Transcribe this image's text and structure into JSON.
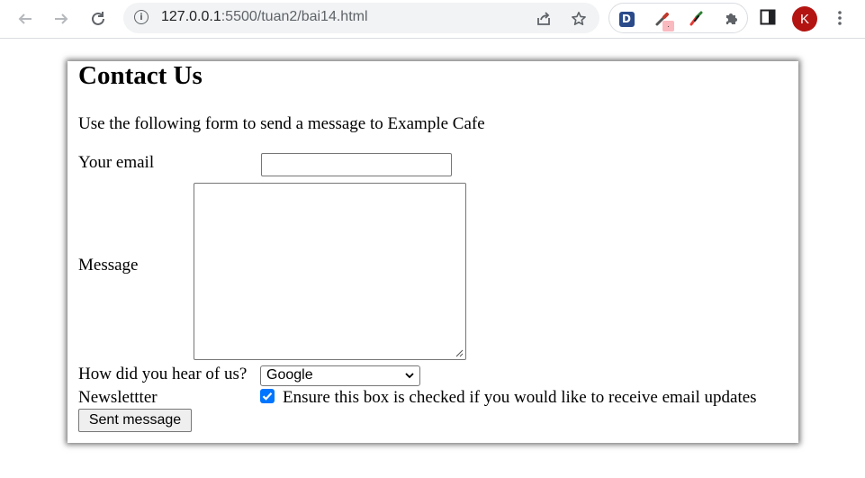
{
  "browser": {
    "url_host": "127.0.0.1",
    "url_rest": ":5500/tuan2/bai14.html",
    "profile_initial": "K",
    "extensions": {
      "d_letter": "D",
      "badge_text": "."
    }
  },
  "page": {
    "title": "Contact Us",
    "intro": "Use the following form to send a message to Example Cafe",
    "form": {
      "email_label": "Your email",
      "email_value": "",
      "message_label": "Message",
      "message_value": "",
      "source_label": "How did you hear of us?",
      "source_selected": "Google",
      "newsletter_label": "Newslettter",
      "newsletter_checked": true,
      "newsletter_text": "Ensure this box is checked if you would like to receive email updates",
      "submit_label": "Sent message"
    }
  },
  "colors": {
    "checkbox_accent": "#0075ff",
    "avatar_bg": "#b31412"
  }
}
